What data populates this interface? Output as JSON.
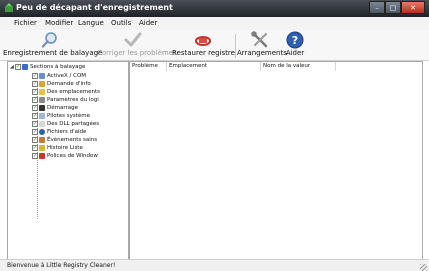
{
  "window": {
    "title": "Peu de décapant d'enregistrement"
  },
  "menu": {
    "items": [
      "Fichier",
      "Modifier",
      "Langue",
      "Outils",
      "Aider"
    ]
  },
  "toolbar": {
    "scan": "Enregistrement de balayage",
    "fix": "Corriger les problèmes",
    "restore": "Restaurer registre",
    "settings": "Arrangements",
    "help": "Aider"
  },
  "tree": {
    "root": "Sections à balayage",
    "items": [
      "ActiveX / COM",
      "Demande d'info",
      "Des emplacements",
      "Paramètres du logi",
      "Démarrage",
      "Pilotes système",
      "Des DLL partagées",
      "Fichiers d'aide",
      "Évènements sains",
      "Histoire Liste",
      "Polices de Window"
    ]
  },
  "results": {
    "columns": [
      "Problème",
      "Emplacement",
      "Nom de la valeur"
    ]
  },
  "status": {
    "text": "Bienvenue à Little Registry Cleaner!"
  },
  "colors": {
    "titlebar": "#2b2f36",
    "close": "#c9402b",
    "check": "#2a7f2a"
  }
}
